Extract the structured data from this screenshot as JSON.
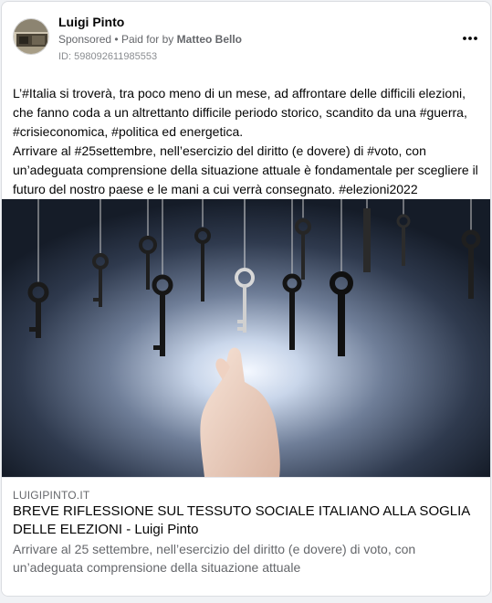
{
  "post": {
    "author": "Luigi Pinto",
    "sponsored_label": "Sponsored",
    "separator": "•",
    "paid_for_prefix": "Paid for by",
    "payer": "Matteo Bello",
    "ad_id": "ID: 598092611985553",
    "more_icon": "more-horizontal-icon",
    "text_lines": [
      "L’#Italia si troverà, tra poco meno di un mese, ad affrontare delle difficili elezioni, che fanno coda a un altrettanto difficile periodo storico, scandito da una #guerra, #crisieconomica, #politica ed energetica.",
      "Arrivare al #25settembre, nell’esercizio del diritto (e dovere) di #voto, con un’adeguata comprensione della situazione attuale è fondamentale per scegliere il futuro del nostro paese e le mani a cui verrà consegnato. #elezioni2022"
    ]
  },
  "link_preview": {
    "domain": "LUIGIPINTO.IT",
    "title": "BREVE RIFLESSIONE SUL TESSUTO SOCIALE ITALIANO ALLA SOGLIA DELLE ELEZIONI - Luigi Pinto",
    "description": "Arrivare al 25 settembre, nell’esercizio del diritto (e dovere) di voto, con un’adeguata comprensione della situazione attuale"
  },
  "colors": {
    "card_bg": "#ffffff",
    "page_bg": "#f0f2f5",
    "secondary_text": "#65676b",
    "image_glow": "#e8f0ff",
    "image_dark": "#1b2434"
  }
}
